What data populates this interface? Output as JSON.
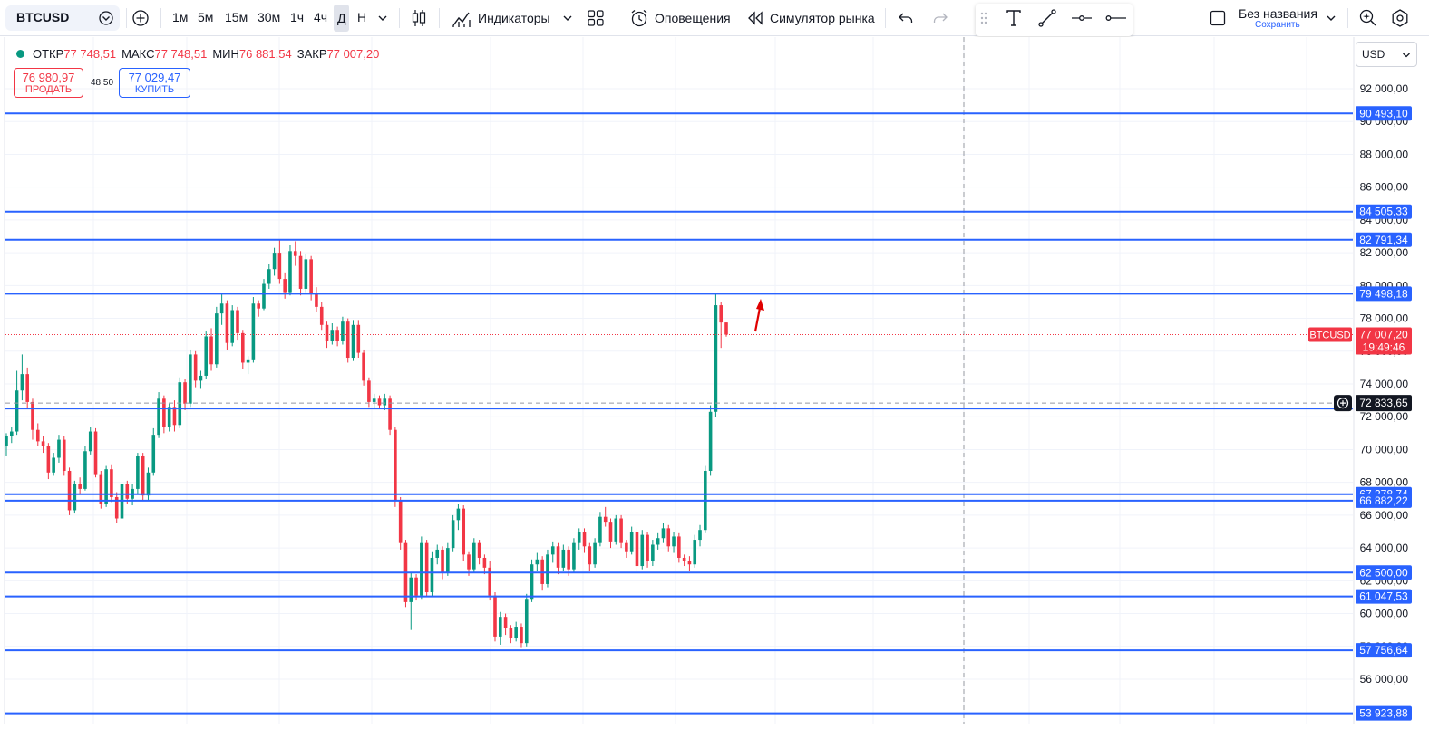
{
  "toolbar": {
    "symbol": "BTCUSD",
    "intervals": [
      {
        "label": "1м",
        "active": false
      },
      {
        "label": "5м",
        "active": false
      },
      {
        "label": "15м",
        "active": false
      },
      {
        "label": "30м",
        "active": false
      },
      {
        "label": "1ч",
        "active": false
      },
      {
        "label": "4ч",
        "active": false
      },
      {
        "label": "Д",
        "active": true
      },
      {
        "label": "Н",
        "active": false
      }
    ],
    "indicators_label": "Индикаторы",
    "alerts_label": "Оповещения",
    "replay_label": "Симулятор рынка",
    "layout_name": "Без названия",
    "save_label": "Сохранить",
    "icons": [
      "plus-circle-icon",
      "chevron-down-icon",
      "candles-icon",
      "indicators-icon",
      "layouts-grid-icon",
      "alarm-clock-icon",
      "rewind-icon",
      "undo-icon",
      "redo-icon",
      "drag-grip-icon",
      "text-tool-icon",
      "trendline-icon",
      "horizontal-ray-icon",
      "horizontal-line-icon",
      "fullscreen-square-icon",
      "settings-gear-icon"
    ]
  },
  "legend": {
    "open_label": "ОТКР",
    "open": "77 748,51",
    "high_label": "МАКС",
    "high": "77 748,51",
    "low_label": "МИН",
    "low": "76 881,54",
    "close_label": "ЗАКР",
    "close": "77 007,20"
  },
  "trade": {
    "sell_price": "76 980,97",
    "sell_label": "ПРОДАТЬ",
    "spread": "48,50",
    "buy_price": "77 029,47",
    "buy_label": "КУПИТЬ"
  },
  "currency": "USD",
  "colors": {
    "up": "#089981",
    "down": "#f23645",
    "hline": "#2962ff",
    "grid": "#f0f3fa",
    "price_line": "#f23645"
  },
  "chart_data": {
    "type": "candlestick",
    "symbol": "BTCUSD",
    "timeframe": "Д",
    "ylim": [
      52600,
      93000
    ],
    "y_ticks": [
      56000,
      58000,
      60000,
      62000,
      64000,
      66000,
      68000,
      70000,
      72000,
      74000,
      76000,
      78000,
      80000,
      82000,
      84000,
      86000,
      88000,
      90000,
      92000
    ],
    "y_tick_labels": [
      "56 000,00",
      "58 000,00",
      "60 000,00",
      "62 000,00",
      "64 000,00",
      "66 000,00",
      "68 000,00",
      "70 000,00",
      "72 000,00",
      "74 000,00",
      "76 000,00",
      "78 000,00",
      "80 000,00",
      "82 000,00",
      "84 000,00",
      "86 000,00",
      "88 000,00",
      "90 000,00",
      "92 000,00"
    ],
    "horizontal_levels": [
      {
        "value": 90493.1,
        "label": "90 493,10"
      },
      {
        "value": 84505.33,
        "label": "84 505,33"
      },
      {
        "value": 82791.34,
        "label": "82 791,34"
      },
      {
        "value": 79498.18,
        "label": "79 498,18"
      },
      {
        "value": 72500,
        "label": ""
      },
      {
        "value": 67278.74,
        "label": "67 278,74"
      },
      {
        "value": 66882.22,
        "label": "66 882,22"
      },
      {
        "value": 62500.0,
        "label": "62 500,00"
      },
      {
        "value": 61047.53,
        "label": "61 047,53"
      },
      {
        "value": 57756.64,
        "label": "57 756,64"
      },
      {
        "value": 53923.88,
        "label": "53 923,88"
      }
    ],
    "last_price": {
      "value": 77007.2,
      "label": "77 007,20",
      "symbol": "BTCUSD",
      "countdown": "19:49:46"
    },
    "crosshair_price": {
      "value": 72833.65,
      "label": "72 833,65"
    },
    "candles": [
      [
        70200,
        71000,
        69600,
        70800
      ],
      [
        70800,
        71400,
        70400,
        71100
      ],
      [
        71100,
        74800,
        70900,
        73600
      ],
      [
        73600,
        75800,
        73000,
        74600
      ],
      [
        74600,
        75000,
        72500,
        72900
      ],
      [
        72900,
        73100,
        70600,
        71200
      ],
      [
        71200,
        71600,
        70200,
        70500
      ],
      [
        70500,
        70800,
        69800,
        70200
      ],
      [
        70200,
        70400,
        68200,
        68600
      ],
      [
        68600,
        69800,
        68400,
        69500
      ],
      [
        69500,
        70900,
        69200,
        70600
      ],
      [
        70600,
        70800,
        68400,
        68700
      ],
      [
        68700,
        68900,
        66000,
        66300
      ],
      [
        66300,
        68100,
        66100,
        67900
      ],
      [
        67900,
        68300,
        67300,
        67600
      ],
      [
        67600,
        70200,
        67500,
        69900
      ],
      [
        69900,
        71400,
        69700,
        71100
      ],
      [
        71100,
        71300,
        68300,
        68500
      ],
      [
        68500,
        68700,
        66400,
        66700
      ],
      [
        66700,
        69000,
        66500,
        68800
      ],
      [
        68800,
        69100,
        66800,
        67100
      ],
      [
        67100,
        67400,
        65500,
        65800
      ],
      [
        65800,
        68200,
        65600,
        67900
      ],
      [
        67900,
        68100,
        66700,
        67000
      ],
      [
        67000,
        67900,
        66600,
        67600
      ],
      [
        67600,
        69800,
        67300,
        69600
      ],
      [
        69600,
        69800,
        66900,
        67200
      ],
      [
        67200,
        68900,
        66900,
        68600
      ],
      [
        68600,
        71300,
        68400,
        70900
      ],
      [
        70900,
        73500,
        70700,
        73100
      ],
      [
        73100,
        73300,
        71000,
        71400
      ],
      [
        71400,
        72800,
        71100,
        72600
      ],
      [
        72600,
        73000,
        71100,
        71500
      ],
      [
        71500,
        74400,
        71300,
        74100
      ],
      [
        74100,
        74300,
        72400,
        72800
      ],
      [
        72800,
        76100,
        72600,
        75800
      ],
      [
        75800,
        76000,
        73800,
        74200
      ],
      [
        74200,
        74800,
        73700,
        74500
      ],
      [
        74500,
        77200,
        74300,
        76900
      ],
      [
        76900,
        77400,
        74800,
        75200
      ],
      [
        75200,
        78700,
        75000,
        78300
      ],
      [
        78300,
        79500,
        77600,
        78900
      ],
      [
        78900,
        79100,
        76100,
        76500
      ],
      [
        76500,
        78800,
        76300,
        78500
      ],
      [
        78500,
        78700,
        76700,
        77100
      ],
      [
        77100,
        77300,
        74900,
        75300
      ],
      [
        75300,
        75700,
        74600,
        75500
      ],
      [
        75500,
        79300,
        75300,
        78900
      ],
      [
        78900,
        79100,
        78100,
        78600
      ],
      [
        78600,
        80400,
        78500,
        80100
      ],
      [
        80100,
        81300,
        79800,
        81000
      ],
      [
        81000,
        82300,
        80600,
        82000
      ],
      [
        82000,
        82800,
        80100,
        80400
      ],
      [
        80400,
        80800,
        79200,
        79600
      ],
      [
        79600,
        82500,
        79400,
        82100
      ],
      [
        82100,
        82700,
        81200,
        81800
      ],
      [
        81800,
        82100,
        79400,
        79800
      ],
      [
        79800,
        81900,
        79600,
        81600
      ],
      [
        81600,
        81800,
        79100,
        79500
      ],
      [
        79500,
        79900,
        78400,
        78700
      ],
      [
        78700,
        79000,
        77300,
        77600
      ],
      [
        77600,
        77800,
        76200,
        76600
      ],
      [
        76600,
        77700,
        76400,
        77300
      ],
      [
        77300,
        77500,
        76300,
        76600
      ],
      [
        76600,
        78100,
        76400,
        77800
      ],
      [
        77800,
        78000,
        75300,
        75600
      ],
      [
        75600,
        77900,
        75400,
        77600
      ],
      [
        77600,
        77900,
        75600,
        75900
      ],
      [
        75900,
        76100,
        73900,
        74200
      ],
      [
        74200,
        74400,
        72600,
        72900
      ],
      [
        72900,
        73400,
        72500,
        73100
      ],
      [
        73100,
        73300,
        72500,
        72700
      ],
      [
        72700,
        73400,
        72400,
        73100
      ],
      [
        73100,
        73300,
        70900,
        71200
      ],
      [
        71200,
        71400,
        66500,
        66900
      ],
      [
        66900,
        67100,
        63900,
        64300
      ],
      [
        64300,
        64500,
        60400,
        60700
      ],
      [
        60700,
        62500,
        59000,
        62200
      ],
      [
        62200,
        62400,
        60800,
        61100
      ],
      [
        61100,
        64700,
        60900,
        64300
      ],
      [
        64300,
        64500,
        61000,
        61300
      ],
      [
        61300,
        63800,
        61000,
        63400
      ],
      [
        63400,
        64200,
        63000,
        63900
      ],
      [
        63900,
        64100,
        62100,
        62500
      ],
      [
        62500,
        64300,
        62300,
        64000
      ],
      [
        64000,
        66000,
        63800,
        65700
      ],
      [
        65700,
        66700,
        65100,
        66400
      ],
      [
        66400,
        66600,
        63200,
        63600
      ],
      [
        63600,
        63800,
        62300,
        62700
      ],
      [
        62700,
        64600,
        62500,
        64300
      ],
      [
        64300,
        64500,
        63000,
        63400
      ],
      [
        63400,
        63600,
        62400,
        62800
      ],
      [
        62800,
        63200,
        60800,
        61100
      ],
      [
        61100,
        61300,
        58300,
        58600
      ],
      [
        58600,
        60100,
        58100,
        59800
      ],
      [
        59800,
        60000,
        58700,
        59100
      ],
      [
        59100,
        59300,
        58200,
        58500
      ],
      [
        58500,
        59500,
        58300,
        59200
      ],
      [
        59200,
        59400,
        57900,
        58200
      ],
      [
        58200,
        61200,
        58000,
        60900
      ],
      [
        60900,
        63300,
        60700,
        63000
      ],
      [
        63000,
        63700,
        62600,
        63300
      ],
      [
        63300,
        63500,
        61400,
        61800
      ],
      [
        61800,
        63900,
        61600,
        63600
      ],
      [
        63600,
        64400,
        63100,
        64100
      ],
      [
        64100,
        64300,
        62400,
        62800
      ],
      [
        62800,
        64200,
        62600,
        63900
      ],
      [
        63900,
        64100,
        62300,
        62700
      ],
      [
        62700,
        64600,
        62500,
        64300
      ],
      [
        64300,
        65200,
        63900,
        65000
      ],
      [
        65000,
        65200,
        63700,
        64100
      ],
      [
        64100,
        64300,
        62600,
        63000
      ],
      [
        63000,
        64600,
        62800,
        64300
      ],
      [
        64300,
        66200,
        64100,
        65900
      ],
      [
        65900,
        66500,
        65300,
        65600
      ],
      [
        65600,
        65800,
        64000,
        64400
      ],
      [
        64400,
        66000,
        64200,
        65800
      ],
      [
        65800,
        66000,
        64000,
        64300
      ],
      [
        64300,
        64500,
        63400,
        63800
      ],
      [
        63800,
        65300,
        63600,
        65000
      ],
      [
        65000,
        65200,
        62600,
        62900
      ],
      [
        62900,
        65100,
        62700,
        64800
      ],
      [
        64800,
        65000,
        62800,
        63200
      ],
      [
        63200,
        64500,
        62900,
        64200
      ],
      [
        64200,
        64900,
        63900,
        64600
      ],
      [
        64600,
        65500,
        64300,
        65200
      ],
      [
        65200,
        65400,
        63800,
        64100
      ],
      [
        64100,
        65000,
        63700,
        64700
      ],
      [
        64700,
        64900,
        63100,
        63400
      ],
      [
        63400,
        63600,
        62900,
        63200
      ],
      [
        63200,
        63500,
        62600,
        63000
      ],
      [
        63000,
        64800,
        62800,
        64500
      ],
      [
        64500,
        65400,
        64100,
        65100
      ],
      [
        65100,
        69000,
        64900,
        68700
      ],
      [
        68700,
        72700,
        68400,
        72300
      ],
      [
        72300,
        79500,
        72000,
        78800
      ],
      [
        78800,
        79000,
        76200,
        77748.51
      ],
      [
        77748.51,
        77748.51,
        76881.54,
        77007.2
      ]
    ]
  }
}
